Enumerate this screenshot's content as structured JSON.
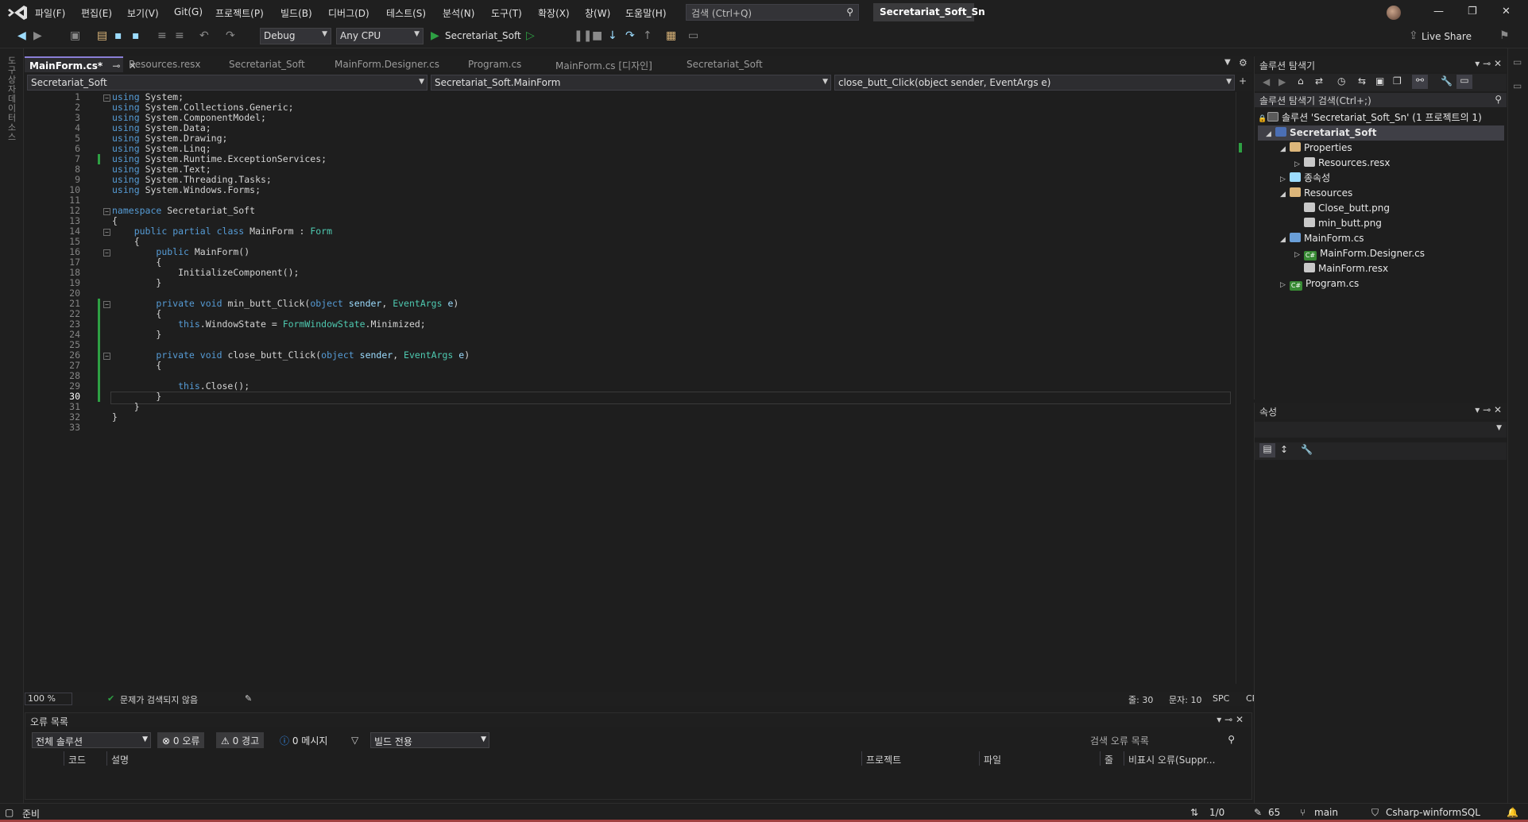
{
  "menu": {
    "items": [
      "파일(F)",
      "편집(E)",
      "보기(V)",
      "Git(G)",
      "프로젝트(P)",
      "빌드(B)",
      "디버그(D)",
      "테스트(S)",
      "분석(N)",
      "도구(T)",
      "확장(X)",
      "창(W)",
      "도움말(H)"
    ],
    "search_placeholder": "검색 (Ctrl+Q)",
    "solution_name": "Secretariat_Soft_Sn"
  },
  "toolbar": {
    "config": "Debug",
    "platform": "Any CPU",
    "run_target": "Secretariat_Soft",
    "live_share": "Live Share"
  },
  "left_strip": {
    "label": "도구 상자 데이터 소스"
  },
  "tabs": [
    {
      "label": "MainForm.cs*",
      "active": true
    },
    {
      "label": "Resources.resx"
    },
    {
      "label": "Secretariat_Soft"
    },
    {
      "label": "MainForm.Designer.cs"
    },
    {
      "label": "Program.cs"
    },
    {
      "label": "MainForm.cs [디자인]"
    },
    {
      "label": "Secretariat_Soft"
    }
  ],
  "nav": {
    "project": "Secretariat_Soft",
    "type": "Secretariat_Soft.MainForm",
    "member": "close_butt_Click(object sender, EventArgs e)"
  },
  "code": {
    "current_line": 30,
    "lines": [
      "using System;",
      "using System.Collections.Generic;",
      "using System.ComponentModel;",
      "using System.Data;",
      "using System.Drawing;",
      "using System.Linq;",
      "using System.Runtime.ExceptionServices;",
      "using System.Text;",
      "using System.Threading.Tasks;",
      "using System.Windows.Forms;",
      "",
      "namespace Secretariat_Soft",
      "{",
      "    public partial class MainForm : Form",
      "    {",
      "        public MainForm()",
      "        {",
      "            InitializeComponent();",
      "        }",
      "",
      "        private void min_butt_Click(object sender, EventArgs e)",
      "        {",
      "            this.WindowState = FormWindowState.Minimized;",
      "        }",
      "",
      "        private void close_butt_Click(object sender, EventArgs e)",
      "        {",
      "",
      "            this.Close();",
      "        }",
      "    }",
      "}",
      ""
    ]
  },
  "editor_status": {
    "zoom": "100 %",
    "issues": "문제가 검색되지 않음",
    "line": "줄: 30",
    "col": "문자: 10",
    "spc": "SPC",
    "crlf": "CRLF"
  },
  "error_list": {
    "title": "오류 목록",
    "scope": "전체 솔루션",
    "errors": "0 오류",
    "warnings": "0 경고",
    "messages": "0 메시지",
    "build_filter": "빌드 전용",
    "search": "검색 오류 목록",
    "columns": [
      "코드",
      "설명",
      "프로젝트",
      "파일",
      "줄",
      "비표시 오류(Suppr..."
    ]
  },
  "solution_explorer": {
    "title": "솔루션 탐색기",
    "search": "솔루션 탐색기 검색(Ctrl+;)",
    "items": [
      {
        "label": "솔루션 'Secretariat_Soft_Sn' (1 프로젝트의 1)",
        "icon": "solution-icon"
      },
      {
        "label": "Secretariat_Soft",
        "icon": "csharp-project-icon"
      },
      {
        "label": "Properties",
        "icon": "properties-folder-icon"
      },
      {
        "label": "Resources.resx",
        "icon": "resx-file-icon"
      },
      {
        "label": "종속성",
        "icon": "dependencies-icon"
      },
      {
        "label": "Resources",
        "icon": "folder-icon"
      },
      {
        "label": "Close_butt.png",
        "icon": "image-file-icon"
      },
      {
        "label": "min_butt.png",
        "icon": "image-file-icon"
      },
      {
        "label": "MainForm.cs",
        "icon": "form-file-icon"
      },
      {
        "label": "MainForm.Designer.cs",
        "icon": "csharp-file-icon"
      },
      {
        "label": "MainForm.resx",
        "icon": "resx-file-icon"
      },
      {
        "label": "Program.cs",
        "icon": "csharp-file-icon"
      }
    ]
  },
  "properties": {
    "title": "속성"
  },
  "statusbar": {
    "ready": "준비",
    "lines": "1/0",
    "edits": "65",
    "branch": "main",
    "repo": "Csharp-winformSQL"
  }
}
